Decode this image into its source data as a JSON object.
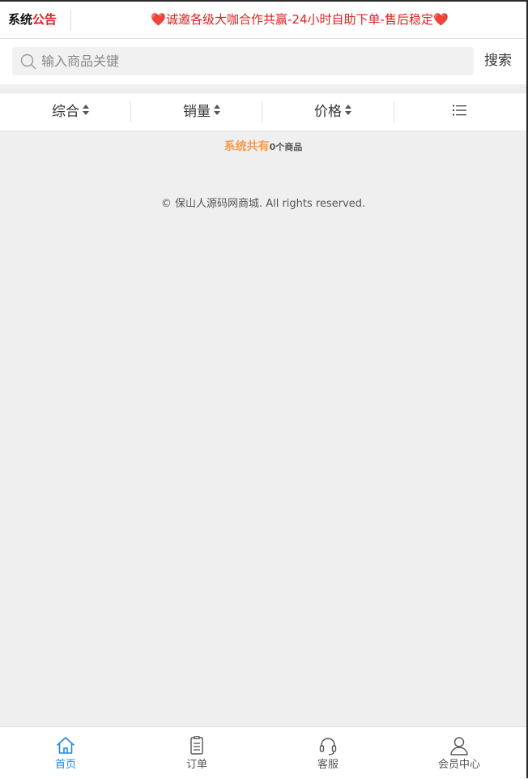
{
  "notice": {
    "label_part1": "系统",
    "label_part2": "公告",
    "text": "❤️诚邀各级大咖合作共赢-24小时自助下单-售后稳定❤️"
  },
  "search": {
    "placeholder": "输入商品关键",
    "button_label": "搜索"
  },
  "sort_tabs": [
    {
      "label": "综合"
    },
    {
      "label": "销量"
    },
    {
      "label": "价格"
    }
  ],
  "list_icon": "list-icon",
  "product_count": {
    "prefix": "系统共有",
    "count_text": "0个商品"
  },
  "footer": {
    "copyright": "© 保山人源码网商城. All rights reserved."
  },
  "bottom_nav": [
    {
      "label": "首页",
      "icon": "home-icon",
      "active": true
    },
    {
      "label": "订单",
      "icon": "order-icon",
      "active": false
    },
    {
      "label": "客服",
      "icon": "headset-icon",
      "active": false
    },
    {
      "label": "会员中心",
      "icon": "user-icon",
      "active": false
    }
  ],
  "colors": {
    "accent": "#1e88e5",
    "notice_red": "#e02020",
    "count_orange": "#f39c4a",
    "background": "#efefef"
  }
}
